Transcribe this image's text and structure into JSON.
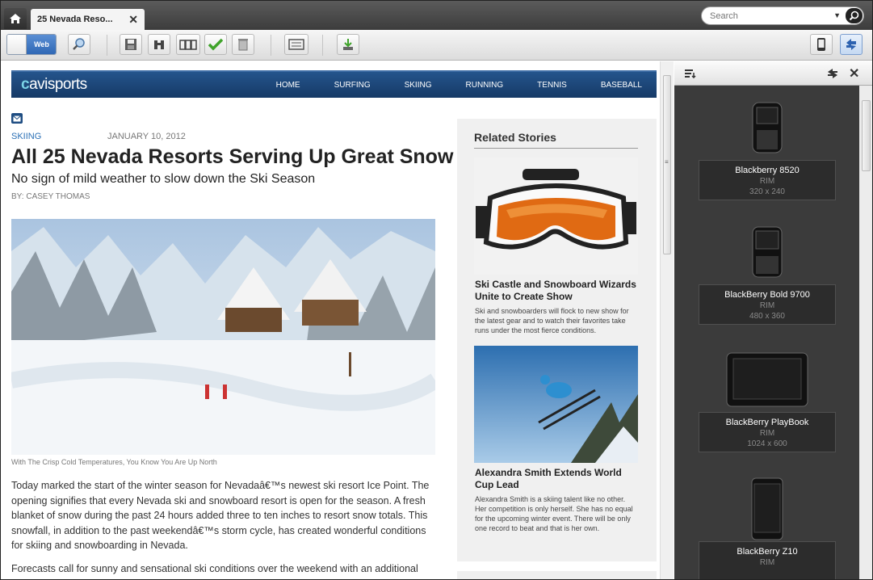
{
  "tab": {
    "title": "25 Nevada Reso...",
    "close": "✕"
  },
  "search": {
    "placeholder": "Search"
  },
  "toolbar": {
    "toggle_label": "Web"
  },
  "site": {
    "logo_prefix": "c",
    "logo_text": "avisports",
    "nav": [
      "HOME",
      "SURFING",
      "SKIING",
      "RUNNING",
      "TENNIS",
      "BASEBALL"
    ]
  },
  "article": {
    "category": "SKIING",
    "date": "JANUARY 10, 2012",
    "headline": "All 25 Nevada Resorts Serving Up Great Snow",
    "subheadline": "No sign of mild weather to slow down the Ski Season",
    "byline": "BY: CASEY THOMAS",
    "caption": "With The Crisp Cold Temperatures, You Know You Are Up North",
    "paragraphs": [
      "Today marked the start of the winter season for Nevadaâ€™s newest ski resort Ice Point. The opening signifies that every Nevada ski and snowboard resort is open for the season. A fresh blanket of snow during the past 24 hours added three to ten inches to resort snow totals. This snowfall, in addition to the past weekendâ€™s storm cycle, has created wonderful conditions for skiing and snowboarding in Nevada.",
      "Forecasts call for sunny and sensational ski conditions over the weekend with an additional"
    ]
  },
  "related": {
    "title": "Related Stories",
    "stories": [
      {
        "title": "Ski Castle and Snowboard Wizards Unite to Create Show",
        "desc": "Ski and snowboarders will flock to new show for the latest gear and to watch their favorites take runs under the most fierce conditions."
      },
      {
        "title": "Alexandra Smith Extends World Cup Lead",
        "desc": "Alexandra Smith is a skiing talent like no other. Her competition is only herself. She has no equal for the upcoming winter event. There will be only one record to beat and that is her own."
      }
    ]
  },
  "devices": [
    {
      "name": "Blackberry 8520",
      "maker": "RIM",
      "res": "320 x 240"
    },
    {
      "name": "BlackBerry Bold 9700",
      "maker": "RIM",
      "res": "480 x 360"
    },
    {
      "name": "BlackBerry PlayBook",
      "maker": "RIM",
      "res": "1024 x 600"
    },
    {
      "name": "BlackBerry Z10",
      "maker": "RIM",
      "res": ""
    }
  ],
  "colors": {
    "nav_bg": "#1c4677",
    "link": "#2a6fb5",
    "panel_bg": "#3b3b3b"
  }
}
